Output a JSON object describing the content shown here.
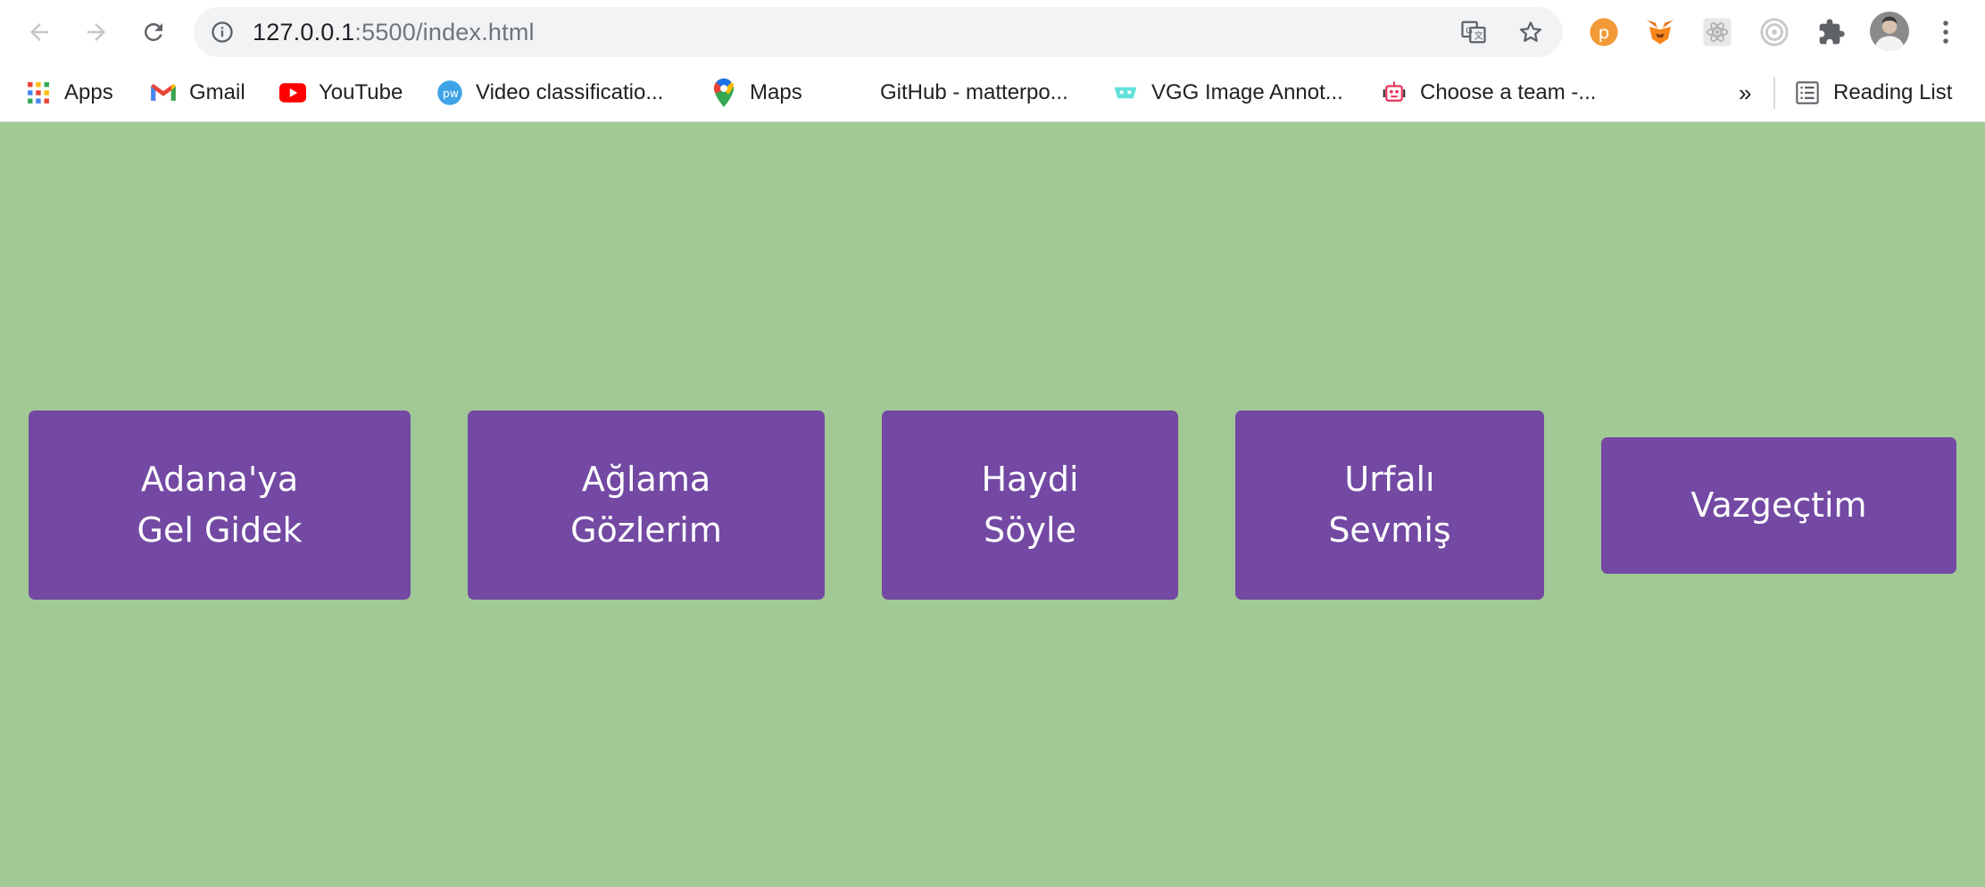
{
  "browser": {
    "url_host": "127.0.0.1",
    "url_path": ":5500/index.html",
    "bookmarks": [
      {
        "label": "Apps",
        "icon": "apps-grid-icon"
      },
      {
        "label": "Gmail",
        "icon": "gmail-icon"
      },
      {
        "label": "YouTube",
        "icon": "youtube-icon"
      },
      {
        "label": "Video classificatio...",
        "icon": "pwc-icon"
      },
      {
        "label": "Maps",
        "icon": "maps-pin-icon"
      },
      {
        "label": "GitHub - matterpo...",
        "icon": "none"
      },
      {
        "label": "VGG Image Annot...",
        "icon": "vgg-icon"
      },
      {
        "label": "Choose a team -...",
        "icon": "robot-icon"
      }
    ],
    "overflow_label": "»",
    "reading_list_label": "Reading List"
  },
  "songs": [
    {
      "label": "Adana'ya\nGel Gidek"
    },
    {
      "label": "Ağlama\nGözlerim"
    },
    {
      "label": "Haydi\nSöyle"
    },
    {
      "label": "Urfalı\nSevmiş"
    },
    {
      "label": "Vazgeçtim"
    }
  ],
  "colors": {
    "page_background": "#a1c995",
    "button_background": "#7349a3",
    "button_text": "#ffffff"
  }
}
